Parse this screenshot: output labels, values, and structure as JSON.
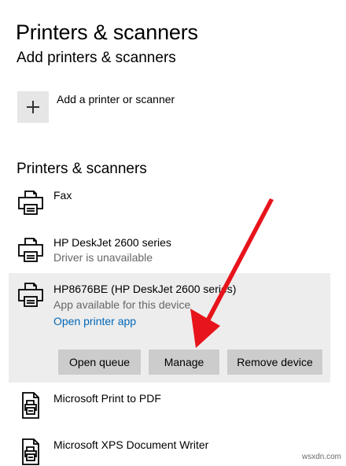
{
  "page": {
    "title": "Printers & scanners"
  },
  "add_section": {
    "title": "Add printers & scanners",
    "add_label": "Add a printer or scanner"
  },
  "list_section": {
    "title": "Printers & scanners",
    "printers": [
      {
        "name": "Fax",
        "icon": "printer-icon"
      },
      {
        "name": "HP DeskJet 2600 series",
        "status": "Driver is unavailable",
        "icon": "printer-icon"
      },
      {
        "name": "HP8676BE (HP DeskJet 2600 series)",
        "status": "App available for this device",
        "link": "Open printer app",
        "icon": "printer-icon",
        "selected": true,
        "actions": {
          "open_queue": "Open queue",
          "manage": "Manage",
          "remove_device": "Remove device"
        }
      },
      {
        "name": "Microsoft Print to PDF",
        "icon": "document-printer-icon"
      },
      {
        "name": "Microsoft XPS Document Writer",
        "icon": "document-printer-icon"
      }
    ]
  },
  "annotation": {
    "arrow_color": "#e8141b",
    "points_to": "Manage"
  },
  "colors": {
    "link": "#0067b8",
    "selected_row_bg": "#ededed",
    "button_bg": "#cccccc",
    "tile_bg": "#e6e6e6",
    "secondary_text": "#666666"
  },
  "watermark": "wsxdn.com"
}
